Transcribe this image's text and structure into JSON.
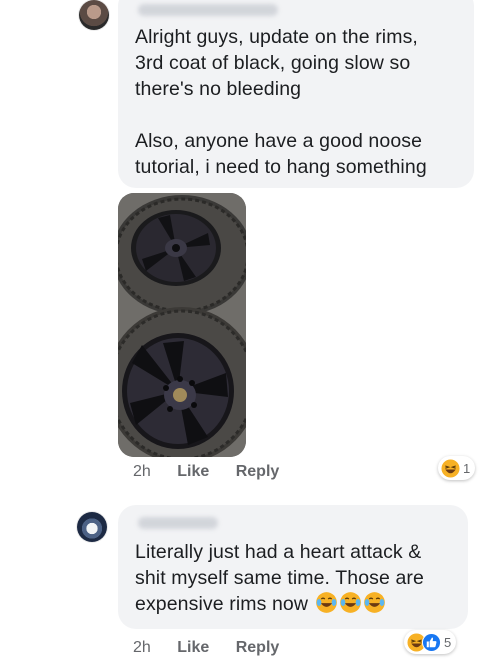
{
  "comments": [
    {
      "author_redacted": true,
      "text_lines": [
        "Alright guys, update on the rims,",
        "3rd coat of black, going slow so",
        "there's no bleeding"
      ],
      "text_lines_2": [
        "Also, anyone have a good noose",
        "tutorial, i need to hang something"
      ],
      "attachment": "photo-of-black-rims",
      "time": "2h",
      "like_label": "Like",
      "reply_label": "Reply",
      "reactions": {
        "icons": [
          "haha-icon"
        ],
        "count": "1"
      }
    },
    {
      "author_redacted": true,
      "text_lines": [
        "Literally just had a heart attack &",
        "shit myself same time. Those are",
        "expensive rims now"
      ],
      "trailing_emojis": [
        "tears-of-joy-icon",
        "tears-of-joy-icon",
        "tears-of-joy-icon"
      ],
      "time": "2h",
      "like_label": "Like",
      "reply_label": "Reply",
      "reactions": {
        "icons": [
          "haha-icon",
          "like-icon"
        ],
        "count": "5"
      }
    }
  ],
  "colors": {
    "bubble": "#f2f3f5",
    "text": "#1c1e21",
    "meta": "#65676b",
    "like_blue": "#1877f2",
    "haha_yellow": "#f7b125"
  }
}
